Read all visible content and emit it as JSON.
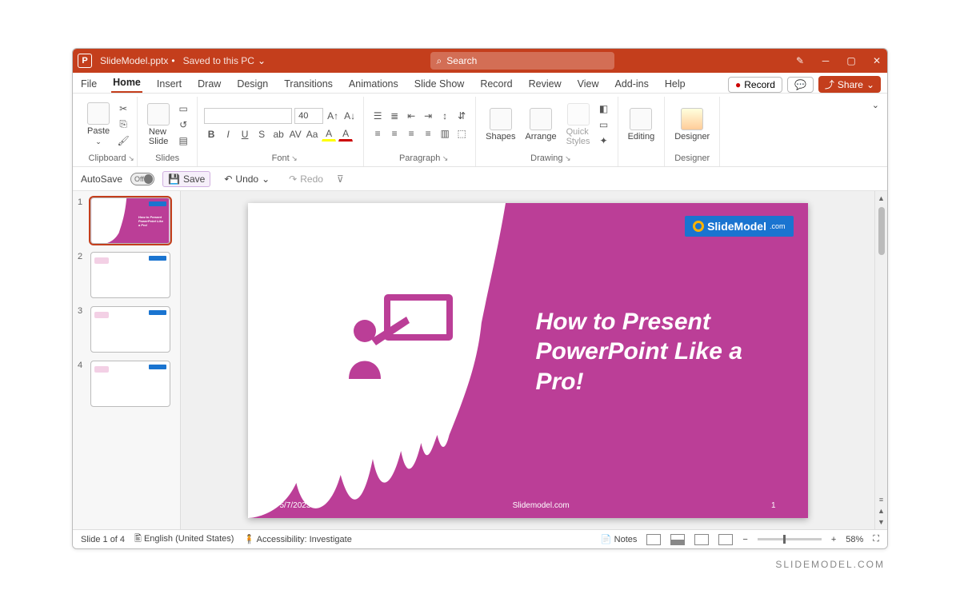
{
  "titlebar": {
    "filename": "SlideModel.pptx",
    "saved_state": "Saved to this PC",
    "search_placeholder": "Search"
  },
  "menu": {
    "tabs": [
      "File",
      "Home",
      "Insert",
      "Draw",
      "Design",
      "Transitions",
      "Animations",
      "Slide Show",
      "Record",
      "Review",
      "View",
      "Add-ins",
      "Help"
    ],
    "active": "Home",
    "record": "Record",
    "share": "Share"
  },
  "ribbon": {
    "clipboard": {
      "paste": "Paste",
      "label": "Clipboard"
    },
    "slides": {
      "newslide": "New\nSlide",
      "label": "Slides"
    },
    "font": {
      "size": "40",
      "label": "Font"
    },
    "paragraph": {
      "label": "Paragraph"
    },
    "drawing": {
      "shapes": "Shapes",
      "arrange": "Arrange",
      "quick": "Quick\nStyles",
      "label": "Drawing"
    },
    "editing": {
      "editing": "Editing",
      "label": ""
    },
    "designer": {
      "designer": "Designer",
      "label": "Designer"
    }
  },
  "qat": {
    "autosave": "AutoSave",
    "autosave_state": "Off",
    "save": "Save",
    "undo": "Undo",
    "redo": "Redo"
  },
  "thumbs": [
    "1",
    "2",
    "3",
    "4"
  ],
  "slide": {
    "logo": "SlideModel",
    "logo_suffix": ".com",
    "title": "How to Present PowerPoint Like a Pro!",
    "date": "5/7/2023",
    "site": "Slidemodel.com",
    "pagenum": "1"
  },
  "status": {
    "slidecount": "Slide 1 of 4",
    "language": "English (United States)",
    "accessibility": "Accessibility: Investigate",
    "notes": "Notes",
    "zoom": "58%"
  },
  "watermark": "SLIDEMODEL.COM"
}
